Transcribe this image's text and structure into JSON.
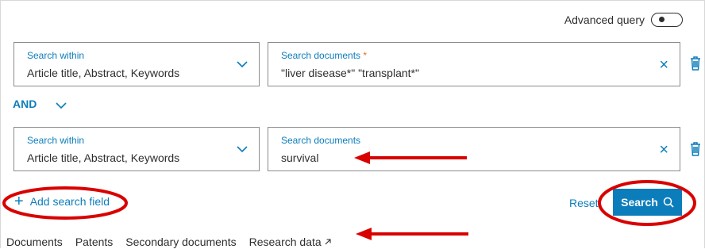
{
  "toolbar": {
    "advanced_query_label": "Advanced query"
  },
  "rows": [
    {
      "within_label": "Search within",
      "within_value": "Article title, Abstract, Keywords",
      "docs_label": "Search documents",
      "docs_required": "*",
      "docs_value": "\"liver disease*\" \"transplant*\""
    },
    {
      "within_label": "Search within",
      "within_value": "Article title, Abstract, Keywords",
      "docs_label": "Search documents",
      "docs_required": "",
      "docs_value": "survival"
    }
  ],
  "operator": {
    "value": "AND"
  },
  "actions": {
    "add_field_label": "Add search field",
    "reset_label": "Reset",
    "search_label": "Search"
  },
  "tabs": [
    "Documents",
    "Patents",
    "Secondary documents",
    "Research data"
  ],
  "icons": {
    "clear": "close-icon",
    "delete": "trash-icon",
    "dropdown": "chevron-down-icon",
    "search": "search-icon",
    "external": "external-link-icon"
  },
  "colors": {
    "accent": "#0c7dbb",
    "annotation": "#d90000"
  }
}
